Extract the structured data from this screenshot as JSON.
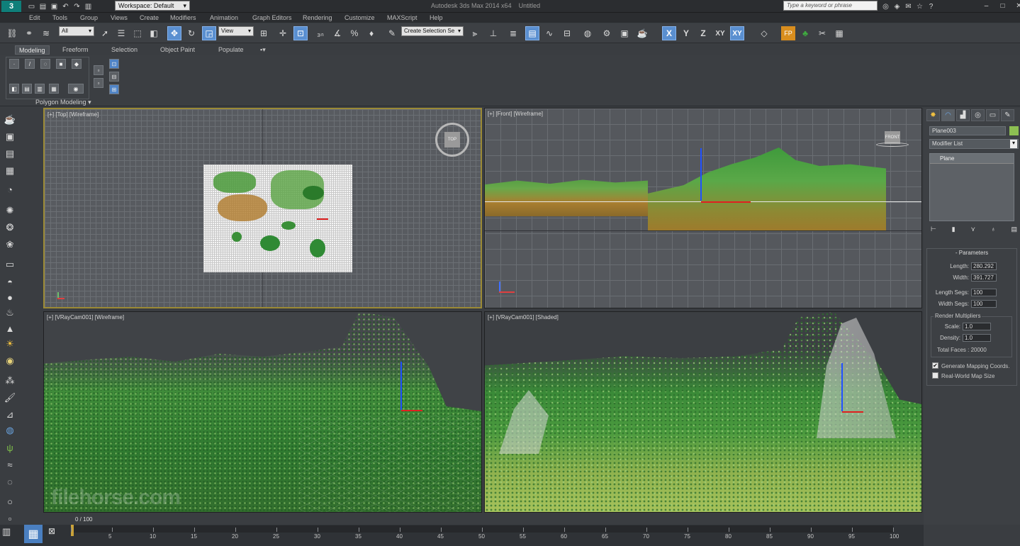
{
  "app": {
    "title": "Autodesk 3ds Max 2014 x64",
    "document": "Untitled",
    "workspace": "Workspace: Default",
    "search_placeholder": "Type a keyword or phrase"
  },
  "menu": [
    "Edit",
    "Tools",
    "Group",
    "Views",
    "Create",
    "Modifiers",
    "Animation",
    "Graph Editors",
    "Rendering",
    "Customize",
    "MAXScript",
    "Help"
  ],
  "toolbar": {
    "selection_filter": "All",
    "ref_coord": "View",
    "named_selection": "Create Selection Se",
    "axis_x": "X",
    "axis_y": "Y",
    "axis_z": "Z",
    "axis_xy": "XY",
    "axis_xy2": "XY"
  },
  "ribbon": {
    "tabs": [
      "Modeling",
      "Freeform",
      "Selection",
      "Object Paint",
      "Populate"
    ],
    "panel_label": "Polygon Modeling"
  },
  "viewports": {
    "top": "[+] [Top] [Wireframe]",
    "front": "[+] [Front] [Wireframe]",
    "cam_wire": "[+] [VRayCam001] [Wireframe]",
    "cam_shaded": "[+] [VRayCam001] [Shaded]",
    "viewcube_top": "TOP",
    "viewcube_front": "FRONT"
  },
  "command_panel": {
    "object_name": "Plane003",
    "object_color": "#8dbf52",
    "modifier_list": "Modifier List",
    "stack_item": "Plane",
    "rollout_parameters": "Parameters",
    "length_label": "Length:",
    "length_value": "280.292",
    "width_label": "Width:",
    "width_value": "391.727",
    "length_segs_label": "Length Segs:",
    "length_segs_value": "100",
    "width_segs_label": "Width Segs:",
    "width_segs_value": "100",
    "render_multipliers": "Render Multipliers",
    "scale_label": "Scale:",
    "scale_value": "1.0",
    "density_label": "Density:",
    "density_value": "1.0",
    "total_faces": "Total Faces : 20000",
    "gen_mapping": "Generate Mapping Coords.",
    "real_world": "Real-World Map Size",
    "gen_mapping_checked": true,
    "real_world_checked": false
  },
  "timeline": {
    "frame_display": "0 / 100",
    "ticks": [
      "0",
      "5",
      "10",
      "15",
      "20",
      "25",
      "30",
      "35",
      "40",
      "45",
      "50",
      "55",
      "60",
      "65",
      "70",
      "75",
      "80",
      "85",
      "90",
      "95",
      "100"
    ]
  },
  "watermark": "filehorse.com"
}
